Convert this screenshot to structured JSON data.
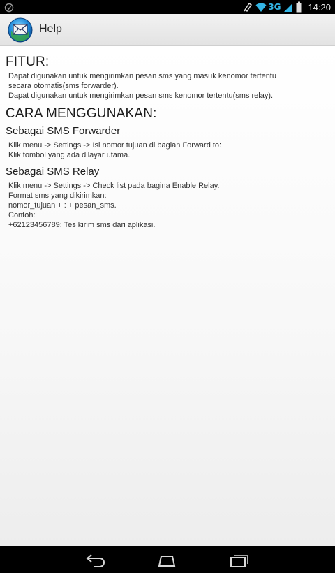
{
  "status_bar": {
    "network": "3G",
    "time": "14:20",
    "accent_color": "#33b5e5"
  },
  "action_bar": {
    "title": "Help",
    "icon": "sms-envelope-app-icon"
  },
  "content": {
    "features": {
      "heading": "FITUR:",
      "lines": [
        "Dapat digunakan untuk mengirimkan pesan sms yang masuk kenomor tertentu",
        "secara otomatis(sms forwarder).",
        "Dapat digunakan untuk mengirimkan pesan sms kenomor tertentu(sms relay)."
      ]
    },
    "usage": {
      "heading": "CARA MENGGUNAKAN:",
      "forwarder": {
        "title": "Sebagai SMS Forwarder",
        "lines": [
          "Klik menu -> Settings -> Isi nomor tujuan di bagian Forward to:",
          "Klik tombol yang ada dilayar utama."
        ]
      },
      "relay": {
        "title": "Sebagai SMS Relay",
        "lines": [
          "Klik menu -> Settings -> Check list pada bagina Enable Relay.",
          "Format sms yang dikirimkan:",
          "nomor_tujuan + : + pesan_sms.",
          "Contoh:",
          "+62123456789: Tes kirim sms dari aplikasi."
        ]
      }
    }
  },
  "nav_bar": {
    "buttons": [
      "back-icon",
      "home-icon",
      "recent-apps-icon"
    ]
  }
}
